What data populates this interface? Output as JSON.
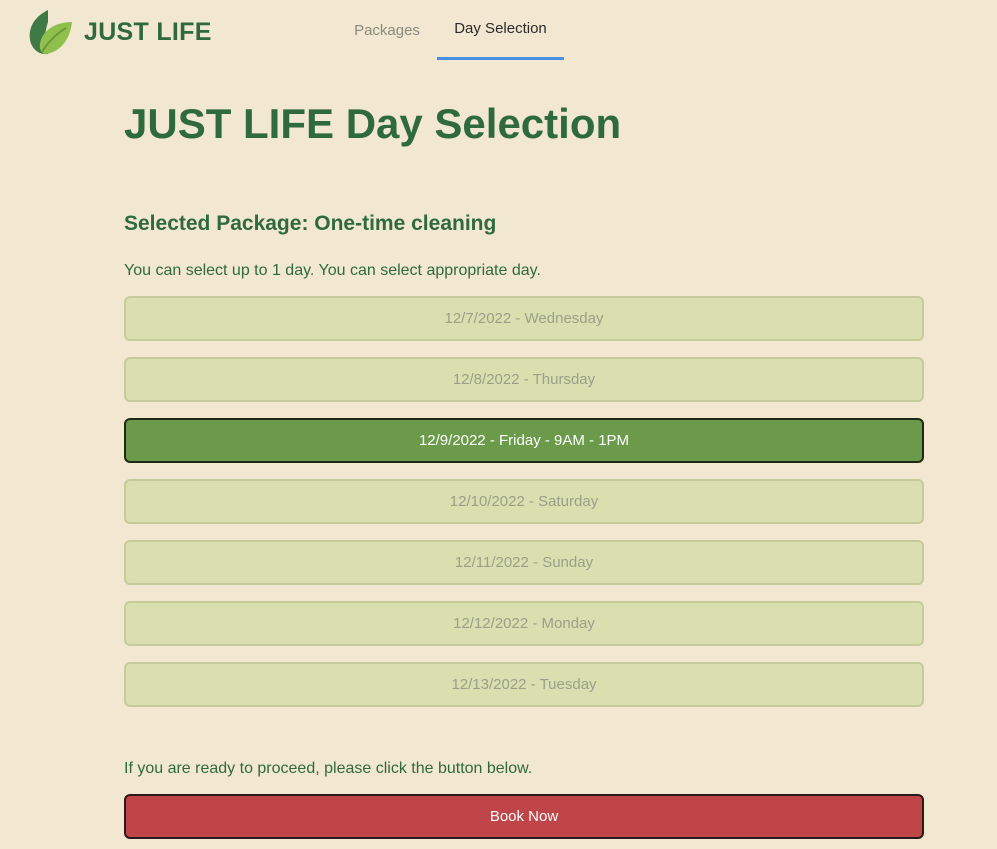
{
  "header": {
    "brand": "JUST LIFE",
    "logo_icon": "leaf-logo-icon",
    "nav": [
      {
        "label": "Packages",
        "active": false
      },
      {
        "label": "Day Selection",
        "active": true
      }
    ]
  },
  "main": {
    "title": "JUST LIFE Day Selection",
    "package_heading": "Selected Package: One-time cleaning",
    "instructions": "You can select up to 1 day. You can select appropriate day.",
    "days": [
      {
        "label": "12/7/2022 - Wednesday",
        "selected": false
      },
      {
        "label": "12/8/2022 - Thursday",
        "selected": false
      },
      {
        "label": "12/9/2022 - Friday - 9AM - 1PM",
        "selected": true
      },
      {
        "label": "12/10/2022 - Saturday",
        "selected": false
      },
      {
        "label": "12/11/2022 - Sunday",
        "selected": false
      },
      {
        "label": "12/12/2022 - Monday",
        "selected": false
      },
      {
        "label": "12/13/2022 - Tuesday",
        "selected": false
      }
    ],
    "proceed_text": "If you are ready to proceed, please click the button below.",
    "book_button": "Book Now"
  },
  "colors": {
    "background": "#f2e7d0",
    "brand_green": "#2f6a3f",
    "selected_day": "#6b9a4b",
    "day_option": "#d9dfae",
    "book_button": "#bf4548",
    "active_tab_underline": "#4a90e2"
  }
}
